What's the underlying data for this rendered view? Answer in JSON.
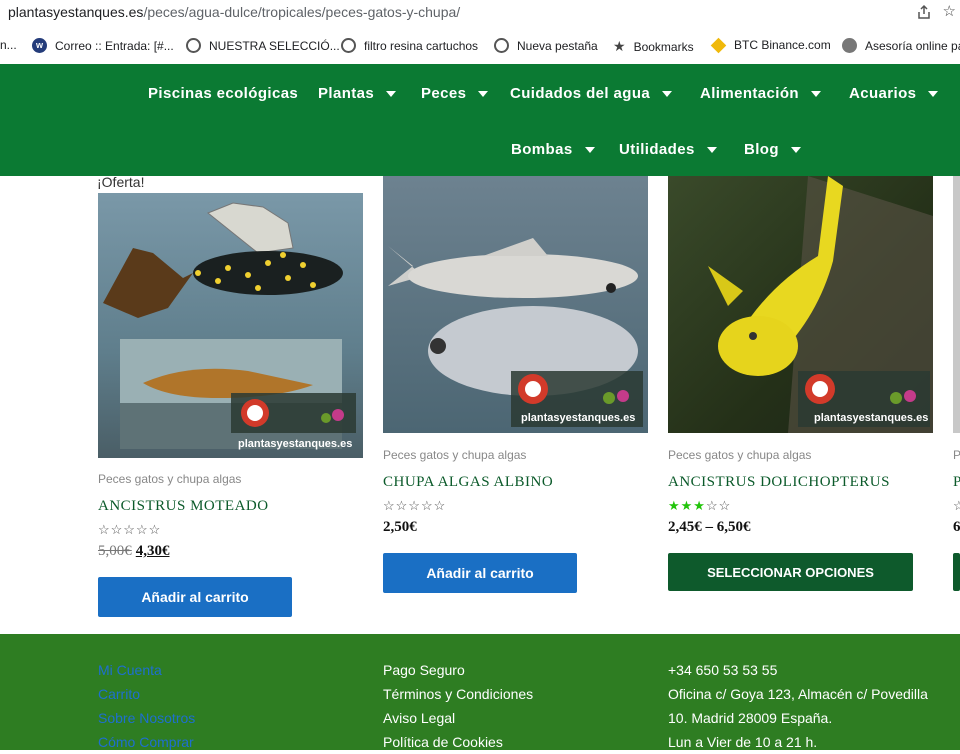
{
  "browser": {
    "url_domain": "plantasyestanques.es",
    "url_path": "/peces/agua-dulce/tropicales/peces-gatos-y-chupa/",
    "bookmarks": [
      {
        "label": "n...",
        "icon": "none"
      },
      {
        "label": "Correo :: Entrada: [#...",
        "icon": "mail-icon"
      },
      {
        "label": "NUESTRA SELECCIÓ...",
        "icon": "globe-icon"
      },
      {
        "label": "filtro resina cartuchos",
        "icon": "globe-icon"
      },
      {
        "label": "Nueva pestaña",
        "icon": "globe-icon"
      },
      {
        "label": "Bookmarks",
        "icon": "star-icon"
      },
      {
        "label": "BTC Binance.com",
        "icon": "binance-icon"
      },
      {
        "label": "Asesoría online pa",
        "icon": "user-icon"
      }
    ]
  },
  "nav": {
    "row1": [
      {
        "label": "Piscinas ecológicas",
        "dropdown": false
      },
      {
        "label": "Plantas",
        "dropdown": true
      },
      {
        "label": "Peces",
        "dropdown": true
      },
      {
        "label": "Cuidados del agua",
        "dropdown": true
      },
      {
        "label": "Alimentación",
        "dropdown": true
      },
      {
        "label": "Acuarios",
        "dropdown": true
      }
    ],
    "row2": [
      {
        "label": "Bombas",
        "dropdown": true
      },
      {
        "label": "Utilidades",
        "dropdown": true
      },
      {
        "label": "Blog",
        "dropdown": true
      }
    ],
    "bg_color": "#0b7a33"
  },
  "products": [
    {
      "badge": "¡Oferta!",
      "category": "Peces gatos y chupa algas",
      "name": "ANCISTRUS MOTEADO",
      "rating_stars": 0,
      "price_old": "5,00€",
      "price": "4,30€",
      "button": "Añadir al carrito",
      "watermark": "plantasyestanques.es"
    },
    {
      "category": "Peces gatos y chupa algas",
      "name": "CHUPA ALGAS ALBINO",
      "rating_stars": 0,
      "price": "2,50€",
      "button": "Añadir al carrito",
      "watermark": "plantasyestanques.es"
    },
    {
      "category": "Peces gatos y chupa algas",
      "name": "ANCISTRUS DOLICHOPTERUS",
      "rating_stars": 3,
      "price": "2,45€ – 6,50€",
      "button": "SELECCIONAR OPCIONES",
      "watermark": "plantasyestanques.es"
    },
    {
      "category": "P",
      "name": "P",
      "price": "6"
    }
  ],
  "colors": {
    "button_blue": "#1a6fc4",
    "button_green": "#0e5a2c",
    "footer_green": "#2e7d22",
    "star_green": "#22c40a"
  },
  "footer": {
    "col1": [
      "Mi Cuenta",
      "Carrito",
      "Sobre Nosotros",
      "Cómo Comprar"
    ],
    "col2": [
      "Pago Seguro",
      "Términos y Condiciones",
      "Aviso Legal",
      "Política de Cookies"
    ],
    "col3": [
      "+34 650 53 53 55",
      "Oficina c/ Goya 123, Almacén c/ Povedilla",
      "10. Madrid 28009 España.",
      "Lun a Vier de 10 a 21 h."
    ]
  }
}
